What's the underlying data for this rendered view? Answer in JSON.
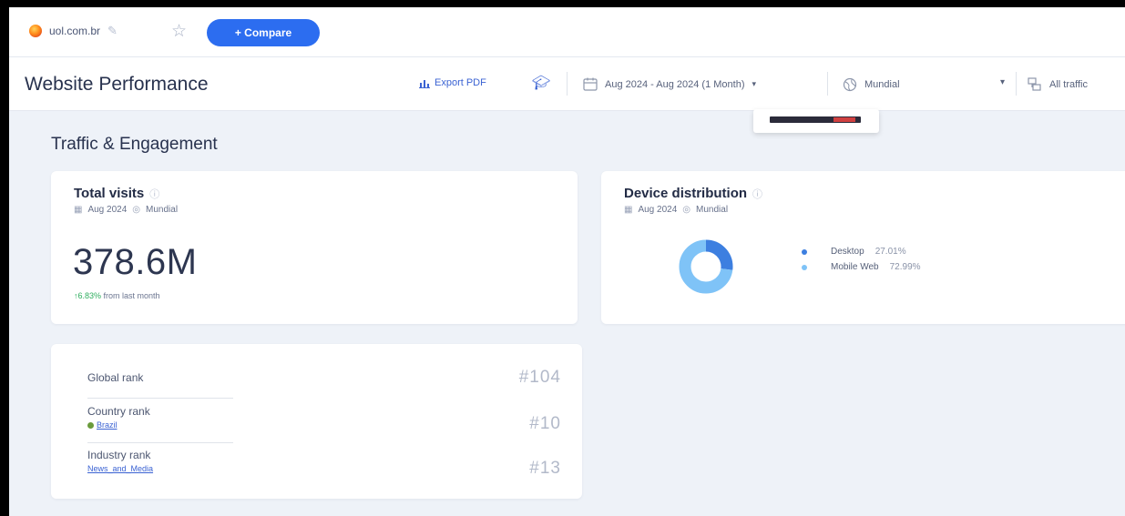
{
  "topbar": {
    "site": "uol.com.br",
    "compare_label": "+ Compare"
  },
  "header": {
    "title": "Website Performance",
    "export_label": "Export PDF",
    "date_range": "Aug 2024 - Aug 2024 (1 Month)",
    "region": "Mundial",
    "traffic": "All traffic"
  },
  "section": {
    "title": "Traffic & Engagement"
  },
  "total_visits": {
    "title": "Total visits",
    "period": "Aug 2024",
    "region": "Mundial",
    "value": "378.6M",
    "change_pct": "6.83%",
    "change_text": "from last month",
    "change_color": "#2fae5f"
  },
  "device_distribution": {
    "title": "Device distribution",
    "period": "Aug 2024",
    "region": "Mundial",
    "items": [
      {
        "label": "Desktop",
        "value": "27.01%",
        "share": 27.01,
        "color": "#3d7fe0"
      },
      {
        "label": "Mobile Web",
        "value": "72.99%",
        "share": 72.99,
        "color": "#7fc3f7"
      }
    ]
  },
  "ranks": {
    "global_label": "Global rank",
    "global_value": "#104",
    "country_label": "Country rank",
    "country_name": "Brazil",
    "country_value": "#10",
    "industry_label": "Industry rank",
    "industry_name": "News_and_Media",
    "industry_value": "#13"
  },
  "colors": {
    "accent": "#2c6df0",
    "link": "#3b63d3",
    "background": "#eef2f8"
  }
}
